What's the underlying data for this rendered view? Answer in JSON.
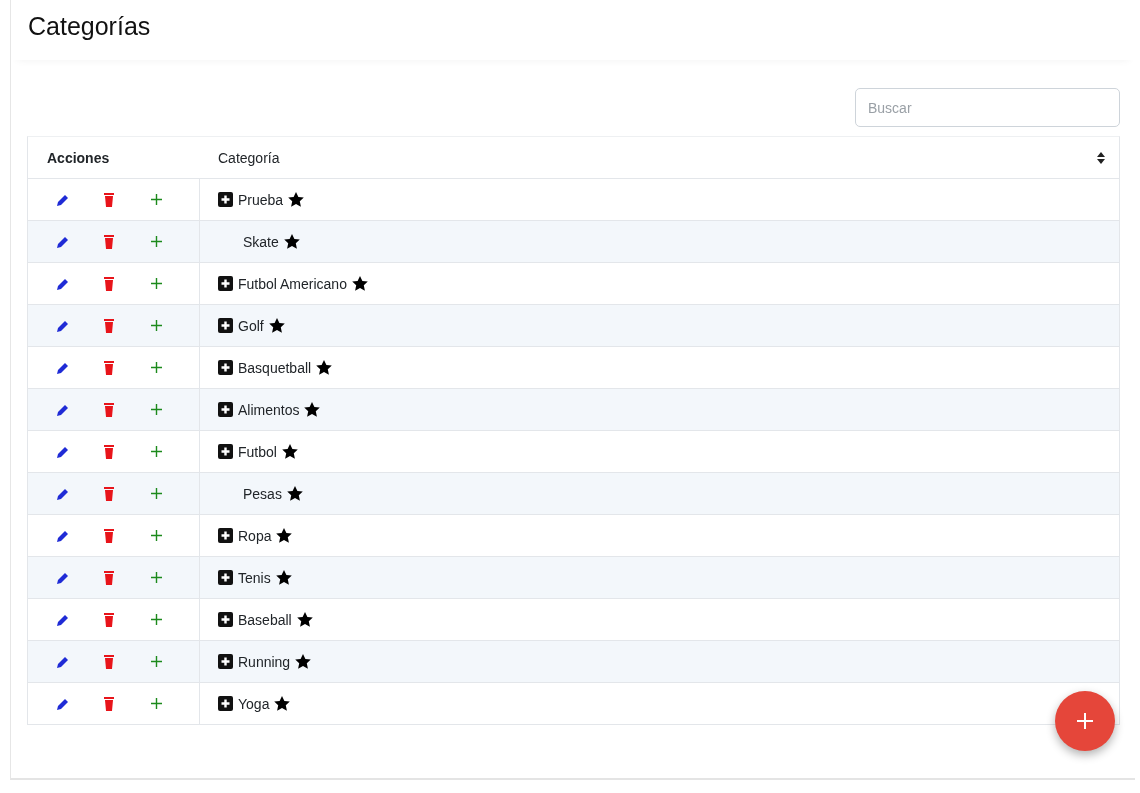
{
  "title": "Categorías",
  "search": {
    "placeholder": "Buscar"
  },
  "table": {
    "columns": [
      "Acciones",
      "Categoría"
    ],
    "rows": [
      {
        "name": "Prueba",
        "expandable": true
      },
      {
        "name": "Skate",
        "expandable": false
      },
      {
        "name": "Futbol Americano",
        "expandable": true
      },
      {
        "name": "Golf",
        "expandable": true
      },
      {
        "name": "Basquetball",
        "expandable": true
      },
      {
        "name": "Alimentos",
        "expandable": true
      },
      {
        "name": "Futbol",
        "expandable": true
      },
      {
        "name": "Pesas",
        "expandable": false
      },
      {
        "name": "Ropa",
        "expandable": true
      },
      {
        "name": "Tenis",
        "expandable": true
      },
      {
        "name": "Baseball",
        "expandable": true
      },
      {
        "name": "Running",
        "expandable": true
      },
      {
        "name": "Yoga",
        "expandable": true
      }
    ]
  }
}
